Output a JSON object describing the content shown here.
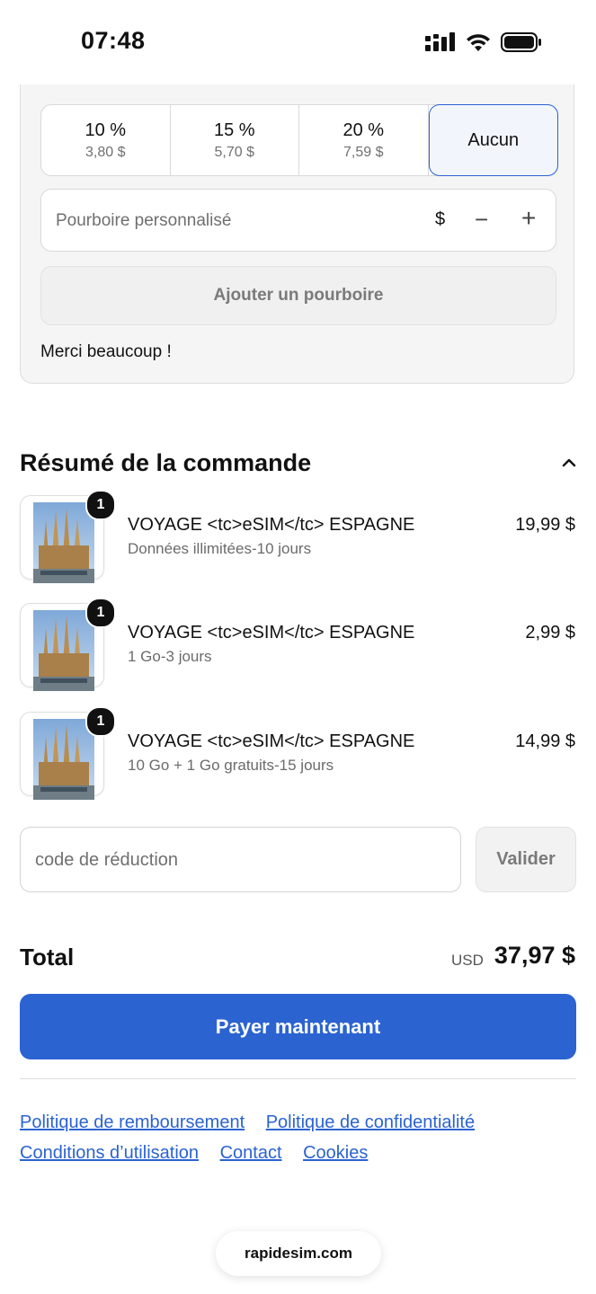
{
  "status_bar": {
    "time": "07:48"
  },
  "tip": {
    "options": [
      {
        "percent": "10 %",
        "amount": "3,80 $"
      },
      {
        "percent": "15 %",
        "amount": "5,70 $"
      },
      {
        "percent": "20 %",
        "amount": "7,59 $"
      }
    ],
    "none_label": "Aucun",
    "custom_placeholder": "Pourboire personnalisé",
    "currency_symbol": "$",
    "minus": "−",
    "plus": "+",
    "add_button": "Ajouter un pourboire",
    "thanks": "Merci beaucoup !"
  },
  "summary": {
    "title": "Résumé de la commande",
    "items": [
      {
        "qty": "1",
        "title": "VOYAGE <tc>eSIM</tc> ESPAGNE",
        "subtitle": "Données illimitées-10 jours",
        "price": "19,99 $"
      },
      {
        "qty": "1",
        "title": "VOYAGE <tc>eSIM</tc> ESPAGNE",
        "subtitle": "1 Go-3 jours",
        "price": "2,99 $"
      },
      {
        "qty": "1",
        "title": "VOYAGE <tc>eSIM</tc> ESPAGNE",
        "subtitle": "10 Go + 1 Go gratuits-15 jours",
        "price": "14,99 $"
      }
    ]
  },
  "discount": {
    "placeholder": "code de réduction",
    "apply_label": "Valider"
  },
  "total": {
    "label": "Total",
    "currency": "USD",
    "amount": "37,97 $"
  },
  "pay_button": "Payer maintenant",
  "footer_links": [
    "Politique de remboursement",
    "Politique de confidentialité",
    "Conditions d’utilisation",
    "Contact",
    "Cookies"
  ],
  "domain": "rapidesim.com",
  "colors": {
    "accent": "#2b63d1",
    "selected_bg": "#f2f6fc"
  }
}
